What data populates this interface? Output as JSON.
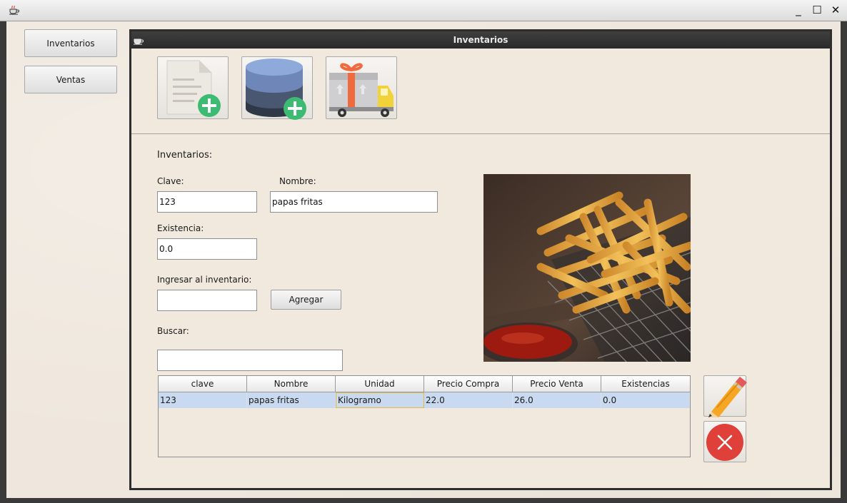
{
  "window": {
    "controls": {
      "minimize": "_",
      "maximize": "☐",
      "close": "✕"
    }
  },
  "nav": {
    "inventarios_label": "Inventarios",
    "ventas_label": "Ventas"
  },
  "frame": {
    "title": "Inventarios"
  },
  "toolbar": {
    "icons": [
      "new-document-icon",
      "add-database-icon",
      "delivery-truck-icon"
    ]
  },
  "form": {
    "section_title": "Inventarios:",
    "clave_label": "Clave:",
    "clave_value": "123",
    "nombre_label": "Nombre:",
    "nombre_value": "papas fritas",
    "existencia_label": "Existencia:",
    "existencia_value": "0.0",
    "ingresar_label": "Ingresar al inventario:",
    "ingresar_value": "",
    "agregar_label": "Agregar",
    "buscar_label": "Buscar:",
    "buscar_value": ""
  },
  "table": {
    "columns": [
      "clave",
      "Nombre",
      "Unidad",
      "Precio Compra",
      "Precio Venta",
      "Existencias"
    ],
    "rows": [
      [
        "123",
        "papas fritas",
        "Kilogramo",
        "22.0",
        "26.0",
        "0.0"
      ]
    ]
  },
  "side_actions": {
    "icons": [
      "pencil-edit-icon",
      "delete-icon"
    ]
  },
  "colors": {
    "background": "#efe7dd",
    "frame_titlebar": "#2e2e2e",
    "selected_row": "#c9d9ef",
    "delete_red": "#e0403a",
    "add_green": "#3dbb73"
  }
}
